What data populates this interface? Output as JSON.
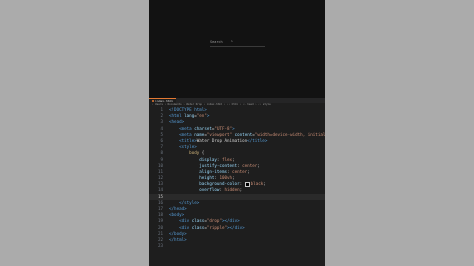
{
  "preview": {
    "search_label": "Search",
    "cursor_glyph": "⌃"
  },
  "editor": {
    "tab_label": "index.html",
    "breadcrumb": "‹ Users › Documents › Water Drop › index.html › ‹› html › ‹› head › ‹› style",
    "active_line": 15,
    "swatch_color": "#000000",
    "lines": [
      {
        "n": "1",
        "tokens": [
          [
            "tag",
            "<!DOCTYPE html>"
          ]
        ]
      },
      {
        "n": "2",
        "tokens": [
          [
            "tag",
            "<html "
          ],
          [
            "attr",
            "lang"
          ],
          [
            "txt",
            "="
          ],
          [
            "str",
            "\"en\""
          ],
          [
            "tag",
            ">"
          ]
        ]
      },
      {
        "n": "3",
        "tokens": [
          [
            "tag",
            "<head>"
          ]
        ]
      },
      {
        "n": "4",
        "tokens": [
          [
            "txt",
            "    "
          ],
          [
            "tag",
            "<meta "
          ],
          [
            "attr",
            "charset"
          ],
          [
            "txt",
            "="
          ],
          [
            "str",
            "\"UTF-8\""
          ],
          [
            "tag",
            ">"
          ]
        ]
      },
      {
        "n": "5",
        "tokens": [
          [
            "txt",
            "    "
          ],
          [
            "tag",
            "<meta "
          ],
          [
            "attr",
            "name"
          ],
          [
            "txt",
            "="
          ],
          [
            "str",
            "\"viewport\""
          ],
          [
            "txt",
            " "
          ],
          [
            "attr",
            "content"
          ],
          [
            "txt",
            "="
          ],
          [
            "str",
            "\"width=device-width, initial"
          ]
        ]
      },
      {
        "n": "6",
        "tokens": [
          [
            "txt",
            "    "
          ],
          [
            "tag",
            "<title>"
          ],
          [
            "txt",
            "Water Drop Animation"
          ],
          [
            "tag",
            "</title>"
          ]
        ]
      },
      {
        "n": "7",
        "tokens": [
          [
            "txt",
            "    "
          ],
          [
            "tag",
            "<style>"
          ]
        ]
      },
      {
        "n": "8",
        "tokens": [
          [
            "txt",
            "        "
          ],
          [
            "sel",
            "body"
          ],
          [
            "txt",
            " {"
          ]
        ]
      },
      {
        "n": "9",
        "tokens": [
          [
            "txt",
            "            "
          ],
          [
            "prop",
            "display"
          ],
          [
            "txt",
            ": "
          ],
          [
            "val",
            "flex"
          ],
          [
            "txt",
            ";"
          ]
        ]
      },
      {
        "n": "10",
        "tokens": [
          [
            "txt",
            "            "
          ],
          [
            "prop",
            "justify-content"
          ],
          [
            "txt",
            ": "
          ],
          [
            "val",
            "center"
          ],
          [
            "txt",
            ";"
          ]
        ]
      },
      {
        "n": "11",
        "tokens": [
          [
            "txt",
            "            "
          ],
          [
            "prop",
            "align-items"
          ],
          [
            "txt",
            ": "
          ],
          [
            "val",
            "center"
          ],
          [
            "txt",
            ";"
          ]
        ]
      },
      {
        "n": "12",
        "tokens": [
          [
            "txt",
            "            "
          ],
          [
            "prop",
            "height"
          ],
          [
            "txt",
            ": "
          ],
          [
            "val",
            "100vh"
          ],
          [
            "txt",
            ";"
          ]
        ]
      },
      {
        "n": "13",
        "tokens": [
          [
            "txt",
            "            "
          ],
          [
            "prop",
            "background-color"
          ],
          [
            "txt",
            ": "
          ],
          [
            "swatch",
            ""
          ],
          [
            "val",
            "black"
          ],
          [
            "txt",
            ";"
          ]
        ]
      },
      {
        "n": "14",
        "tokens": [
          [
            "txt",
            "            "
          ],
          [
            "prop",
            "overflow"
          ],
          [
            "txt",
            ": "
          ],
          [
            "val",
            "hidden"
          ],
          [
            "txt",
            ";"
          ]
        ]
      },
      {
        "n": "15",
        "tokens": [
          [
            "txt",
            "        "
          ]
        ]
      },
      {
        "n": "16",
        "tokens": [
          [
            "txt",
            "    "
          ],
          [
            "tag",
            "</style>"
          ]
        ]
      },
      {
        "n": "17",
        "tokens": [
          [
            "tag",
            "</head>"
          ]
        ]
      },
      {
        "n": "18",
        "tokens": [
          [
            "tag",
            "<body>"
          ]
        ]
      },
      {
        "n": "19",
        "tokens": [
          [
            "txt",
            "    "
          ],
          [
            "tag",
            "<div "
          ],
          [
            "attr",
            "class"
          ],
          [
            "txt",
            "="
          ],
          [
            "str",
            "\"drop\""
          ],
          [
            "tag",
            "></div>"
          ]
        ]
      },
      {
        "n": "20",
        "tokens": [
          [
            "txt",
            "    "
          ],
          [
            "tag",
            "<div "
          ],
          [
            "attr",
            "class"
          ],
          [
            "txt",
            "="
          ],
          [
            "str",
            "\"ripple\""
          ],
          [
            "tag",
            "></div>"
          ]
        ]
      },
      {
        "n": "21",
        "tokens": [
          [
            "tag",
            "</body>"
          ]
        ]
      },
      {
        "n": "22",
        "tokens": [
          [
            "tag",
            "</html>"
          ]
        ]
      },
      {
        "n": "23",
        "tokens": []
      }
    ]
  }
}
